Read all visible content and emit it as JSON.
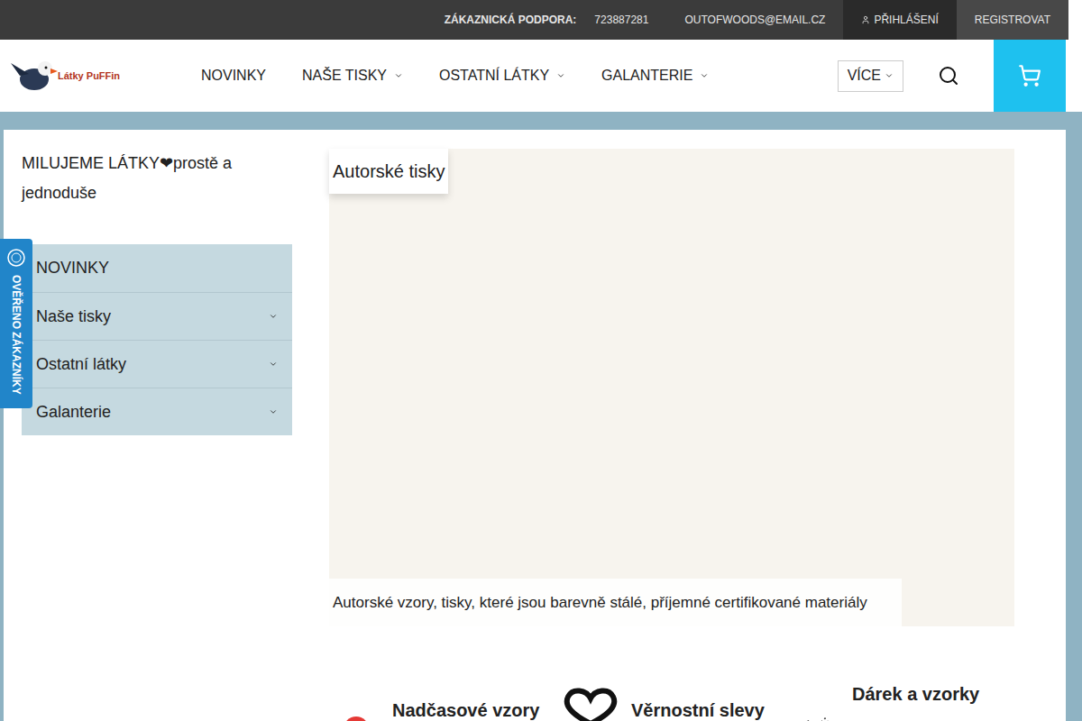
{
  "top_bar": {
    "support_label": "ZÁKAZNICKÁ PODPORA:",
    "phone": "723887281",
    "email": "OUTOFWOODS@EMAIL.CZ",
    "login": "PŘIHLÁŠENÍ",
    "register": "REGISTROVAT"
  },
  "header": {
    "logo_text": "Látky PuFFin",
    "nav": [
      {
        "label": "NOVINKY",
        "has_dropdown": false
      },
      {
        "label": "NAŠE TISKY",
        "has_dropdown": true
      },
      {
        "label": "OSTATNÍ LÁTKY",
        "has_dropdown": true
      },
      {
        "label": "GALANTERIE",
        "has_dropdown": true
      }
    ],
    "more": "VÍCE"
  },
  "badge": {
    "label": "OVĚŘENO ZÁKAZNÍKY"
  },
  "sidebar": {
    "heading": "MILUJEME LÁTKY❤prostě a jednoduše",
    "items": [
      {
        "label": "NOVINKY",
        "has_submenu": false
      },
      {
        "label": "Naše tisky",
        "has_submenu": true
      },
      {
        "label": "Ostatní látky",
        "has_submenu": true
      },
      {
        "label": "Galanterie",
        "has_submenu": true
      }
    ]
  },
  "banner": {
    "label": "Autorské tisky",
    "caption": "Autorské vzory, tisky, které jsou barevně stálé, příjemné certifikované materiály"
  },
  "features": [
    {
      "title": "Nadčasové vzory",
      "kind": "circle"
    },
    {
      "title": "Věrnostní slevy",
      "kind": "heart"
    },
    {
      "title": "Dárek a vzorky",
      "kind": "sketch"
    }
  ]
}
